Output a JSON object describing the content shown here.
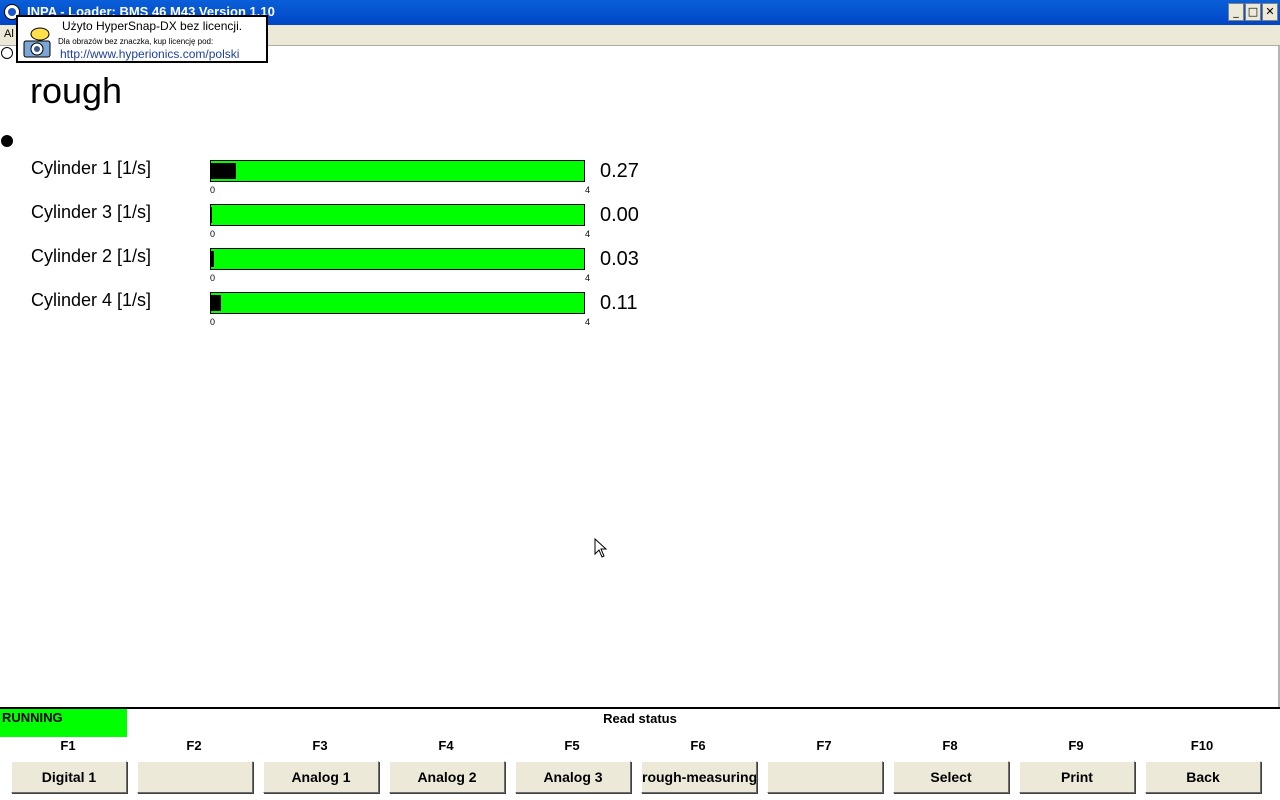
{
  "window": {
    "title": "INPA - Loader:  BMS 46 M43 Version 1.10",
    "min_glyph": "_",
    "max_glyph": "□",
    "close_glyph": "✕"
  },
  "menubar": {
    "first_item": "Al"
  },
  "watermark": {
    "line1": "Użyto HyperSnap-DX bez licencji.",
    "line2": "Dla obrazów bez znaczka, kup licencję pod:",
    "line3": "http://www.hyperionics.com/polski"
  },
  "page": {
    "heading": "rough"
  },
  "measurements": [
    {
      "label": "Cylinder 1 [1/s]",
      "value": "0.27",
      "fraction": 0.0675,
      "min": "0",
      "max": "4"
    },
    {
      "label": "Cylinder 3 [1/s]",
      "value": "0.00",
      "fraction": 0.0,
      "min": "0",
      "max": "4"
    },
    {
      "label": "Cylinder 2 [1/s]",
      "value": "0.03",
      "fraction": 0.0075,
      "min": "0",
      "max": "4"
    },
    {
      "label": "Cylinder 4 [1/s]",
      "value": "0.11",
      "fraction": 0.0275,
      "min": "0",
      "max": "4"
    }
  ],
  "status": {
    "state": "RUNNING",
    "message": "Read status",
    "state_color": "#00ff00"
  },
  "function_keys": [
    {
      "key": "F1",
      "label": "Digital 1"
    },
    {
      "key": "F2",
      "label": ""
    },
    {
      "key": "F3",
      "label": "Analog 1"
    },
    {
      "key": "F4",
      "label": "Analog 2"
    },
    {
      "key": "F5",
      "label": "Analog 3"
    },
    {
      "key": "F6",
      "label": "rough-measuring"
    },
    {
      "key": "F7",
      "label": ""
    },
    {
      "key": "F8",
      "label": "Select"
    },
    {
      "key": "F9",
      "label": "Print"
    },
    {
      "key": "F10",
      "label": "Back"
    }
  ],
  "colors": {
    "bar": "#00ff00",
    "bar_fill": "#000000",
    "titlebar": "#0054e3"
  }
}
